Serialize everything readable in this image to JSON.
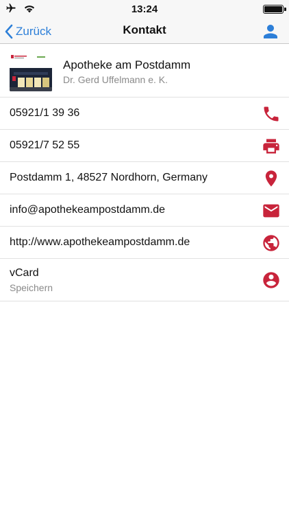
{
  "status_bar": {
    "time": "13:24"
  },
  "nav": {
    "back_label": "Zurück",
    "title": "Kontakt"
  },
  "header": {
    "name": "Apotheke am Postdamm",
    "owner": "Dr. Gerd Uffelmann e. K."
  },
  "rows": [
    {
      "text": "05921/1 39 36",
      "icon": "phone-icon"
    },
    {
      "text": "05921/7 52 55",
      "icon": "printer-icon"
    },
    {
      "text": "Postdamm 1, 48527 Nordhorn, Germany",
      "icon": "map-pin-icon"
    },
    {
      "text": "info@apothekeampostdamm.de",
      "icon": "mail-icon"
    },
    {
      "text": "http://www.apothekeampostdamm.de",
      "icon": "globe-icon"
    },
    {
      "text": "vCard",
      "sub": "Speichern",
      "icon": "account-circle-icon"
    }
  ],
  "colors": {
    "accent_blue": "#2d7fd8",
    "icon_red": "#c8243b"
  }
}
